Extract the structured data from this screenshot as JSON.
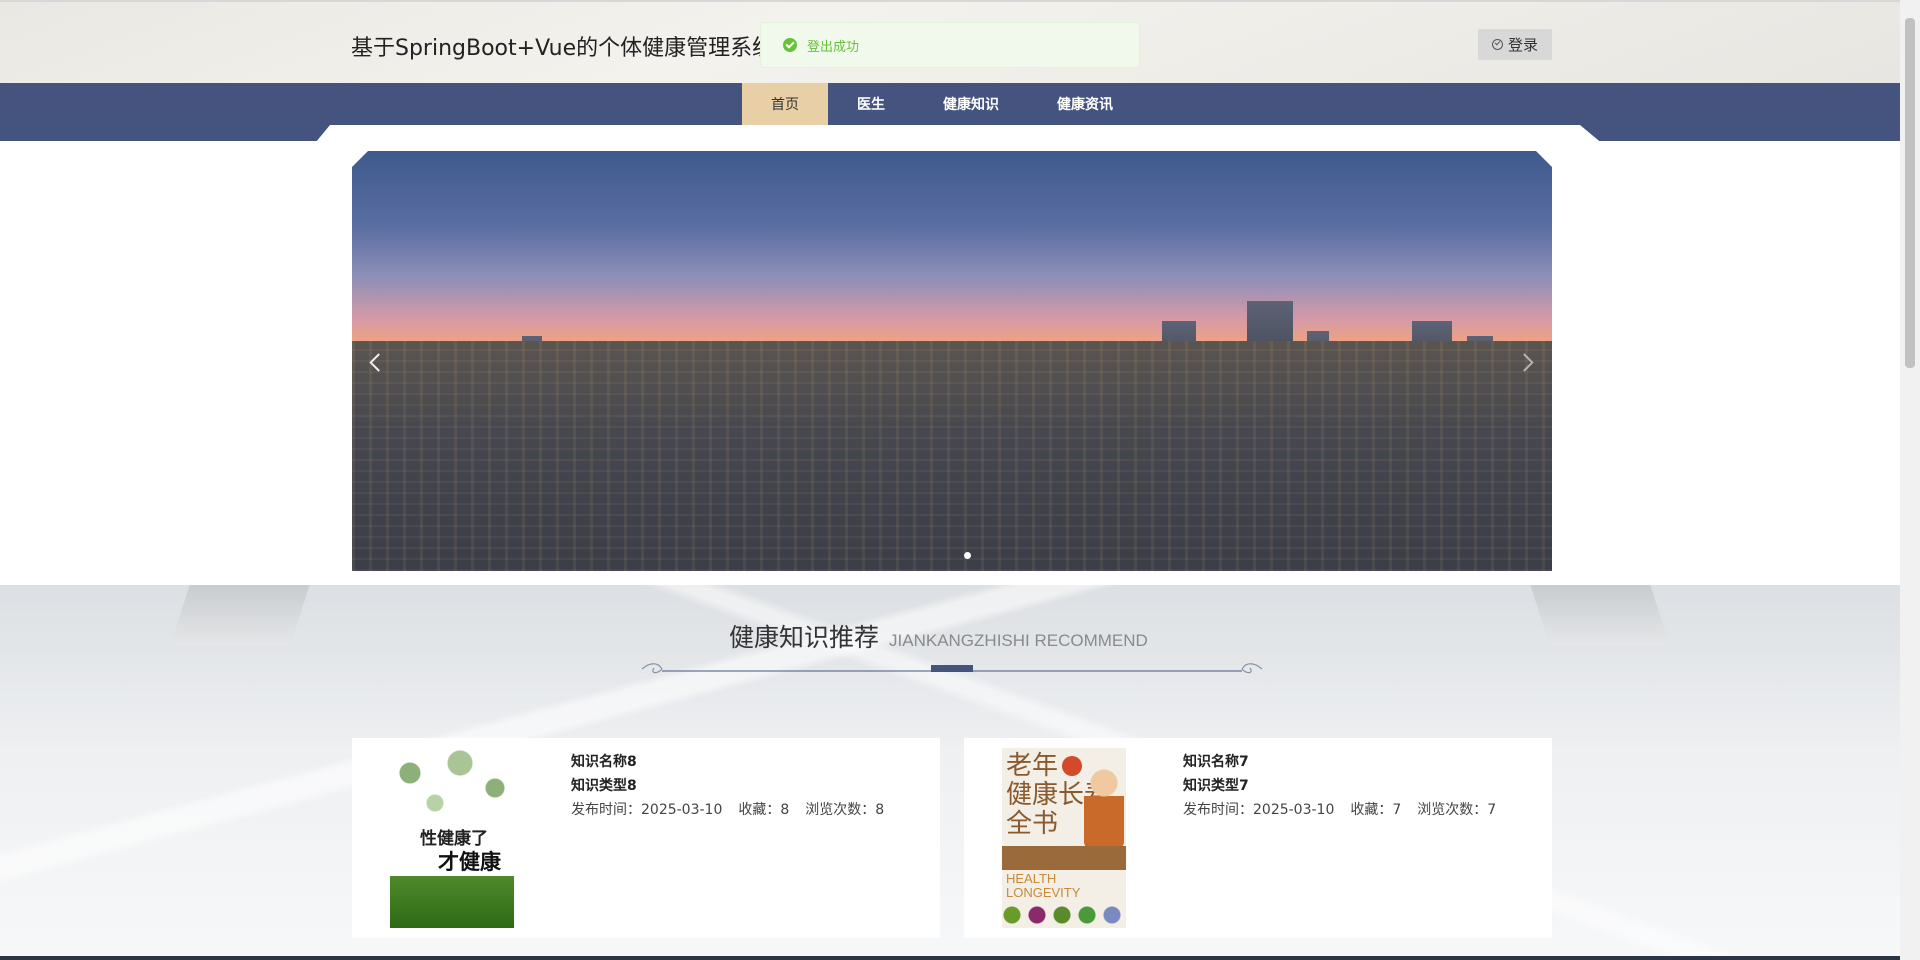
{
  "header": {
    "site_title": "基于SpringBoot+Vue的个体健康管理系统",
    "login_label": "登录"
  },
  "toast": {
    "message": "登出成功",
    "status_color": "#67c23a"
  },
  "nav": {
    "items": [
      {
        "label": "首页",
        "active": true
      },
      {
        "label": "医生",
        "active": false
      },
      {
        "label": "健康知识",
        "active": false
      },
      {
        "label": "健康资讯",
        "active": false
      }
    ]
  },
  "carousel": {
    "slide_count": 1,
    "active_index": 0
  },
  "section": {
    "title_cn": "健康知识推荐",
    "title_en": "JIANKANGZHISHI RECOMMEND"
  },
  "cards": [
    {
      "name": "知识名称8",
      "type": "知识类型8",
      "publish_label": "发布时间：2025-03-10",
      "favorites_label": "收藏：8",
      "views_label": "浏览次数：8",
      "cover": {
        "line1": "性健康了",
        "line2": "才健康"
      }
    },
    {
      "name": "知识名称7",
      "type": "知识类型7",
      "publish_label": "发布时间：2025-03-10",
      "favorites_label": "收藏：7",
      "views_label": "浏览次数：7",
      "cover": {
        "text": "老年健康长寿全书",
        "line1": "老年",
        "line2": "健康长寿",
        "line3": "全书",
        "en1": "HEALTH",
        "en2": "LONGEVITY"
      }
    }
  ],
  "colors": {
    "nav_bg": "#44547e",
    "nav_active": "#e9cfa6"
  }
}
